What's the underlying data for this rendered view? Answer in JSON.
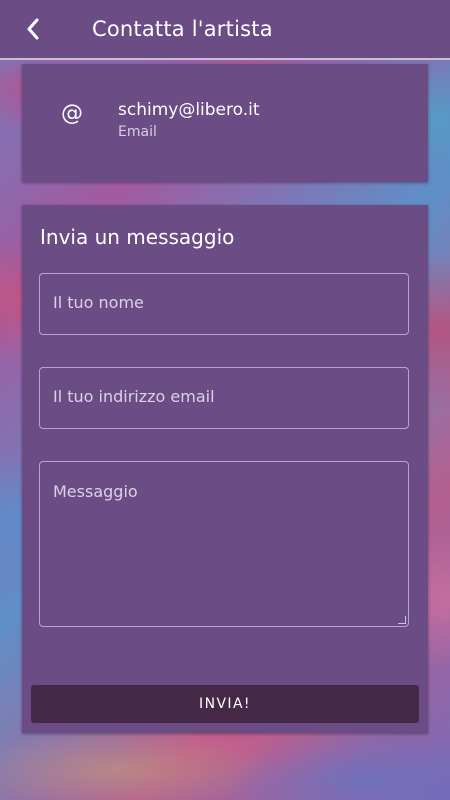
{
  "appbar": {
    "title": "Contatta l'artista",
    "back_icon": "chevron-left-icon"
  },
  "contact": {
    "icon": "at-sign-icon",
    "icon_glyph": "@",
    "value": "schimy@libero.it",
    "type": "Email"
  },
  "form": {
    "title": "Invia un messaggio",
    "name_placeholder": "Il tuo nome",
    "email_placeholder": "Il tuo indirizzo email",
    "message_placeholder": "Messaggio",
    "submit_label": "INVIA!"
  },
  "colors": {
    "surface": "#6b4c85",
    "button": "#452848",
    "text": "#ffffff",
    "secondary_text": "#d8cde2"
  }
}
